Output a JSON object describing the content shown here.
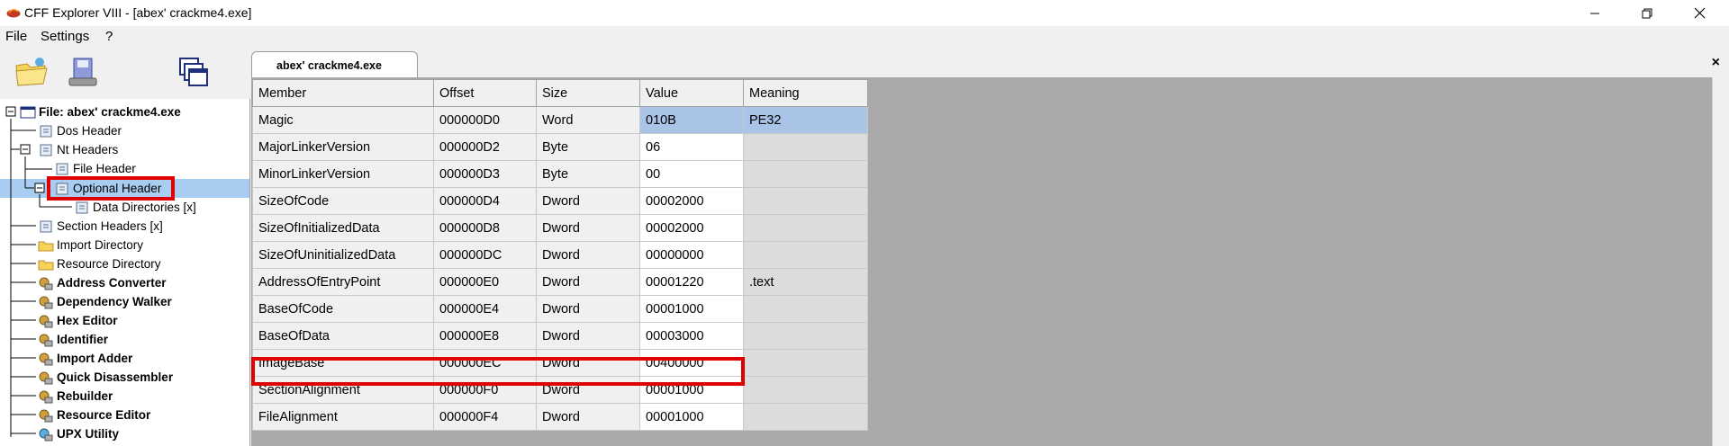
{
  "window": {
    "title": "CFF Explorer VIII - [abex' crackme4.exe]",
    "controls": {
      "minimize": "—",
      "restore": "⧉",
      "close": "✕"
    }
  },
  "menu": [
    "File",
    "Settings",
    "?"
  ],
  "tab": {
    "label": "abex' crackme4.exe",
    "close": "×"
  },
  "tree": {
    "root": "File: abex' crackme4.exe",
    "items": [
      {
        "label": "Dos Header"
      },
      {
        "label": "Nt Headers"
      },
      {
        "label": "File Header"
      },
      {
        "label": "Optional Header"
      },
      {
        "label": "Data Directories [x]"
      },
      {
        "label": "Section Headers [x]"
      },
      {
        "label": "Import Directory"
      },
      {
        "label": "Resource Directory"
      },
      {
        "label": "Address Converter"
      },
      {
        "label": "Dependency Walker"
      },
      {
        "label": "Hex Editor"
      },
      {
        "label": "Identifier"
      },
      {
        "label": "Import Adder"
      },
      {
        "label": "Quick Disassembler"
      },
      {
        "label": "Rebuilder"
      },
      {
        "label": "Resource Editor"
      },
      {
        "label": "UPX Utility"
      }
    ]
  },
  "grid": {
    "headers": [
      "Member",
      "Offset",
      "Size",
      "Value",
      "Meaning"
    ],
    "rows": [
      [
        "Magic",
        "000000D0",
        "Word",
        "010B",
        "PE32"
      ],
      [
        "MajorLinkerVersion",
        "000000D2",
        "Byte",
        "06",
        ""
      ],
      [
        "MinorLinkerVersion",
        "000000D3",
        "Byte",
        "00",
        ""
      ],
      [
        "SizeOfCode",
        "000000D4",
        "Dword",
        "00002000",
        ""
      ],
      [
        "SizeOfInitializedData",
        "000000D8",
        "Dword",
        "00002000",
        ""
      ],
      [
        "SizeOfUninitializedData",
        "000000DC",
        "Dword",
        "00000000",
        ""
      ],
      [
        "AddressOfEntryPoint",
        "000000E0",
        "Dword",
        "00001220",
        ".text"
      ],
      [
        "BaseOfCode",
        "000000E4",
        "Dword",
        "00001000",
        ""
      ],
      [
        "BaseOfData",
        "000000E8",
        "Dword",
        "00003000",
        ""
      ],
      [
        "ImageBase",
        "000000EC",
        "Dword",
        "00400000",
        ""
      ],
      [
        "SectionAlignment",
        "000000F0",
        "Dword",
        "00001000",
        ""
      ],
      [
        "FileAlignment",
        "000000F4",
        "Dword",
        "00001000",
        ""
      ]
    ]
  },
  "colors": {
    "selection": "#a9cdf0",
    "highlight": "#e00000",
    "grid_bg": "#a9a9a9"
  }
}
